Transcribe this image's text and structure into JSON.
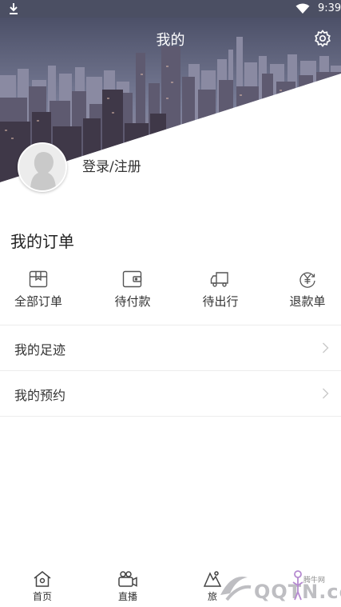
{
  "status_bar": {
    "time": "9:39"
  },
  "header": {
    "title": "我的",
    "settings_icon": "gear-icon"
  },
  "profile": {
    "login_label": "登录/注册",
    "avatar_icon": "default-avatar"
  },
  "orders": {
    "title": "我的订单",
    "items": [
      {
        "label": "全部订单",
        "icon": "box-icon"
      },
      {
        "label": "待付款",
        "icon": "wallet-icon"
      },
      {
        "label": "待出行",
        "icon": "truck-icon"
      },
      {
        "label": "退款单",
        "icon": "refund-icon"
      }
    ]
  },
  "menu": {
    "items": [
      {
        "label": "我的足迹"
      },
      {
        "label": "我的预约"
      }
    ]
  },
  "bottom_nav": {
    "items": [
      {
        "label": "首页",
        "icon": "home-icon"
      },
      {
        "label": "直播",
        "icon": "live-camera-icon"
      },
      {
        "label": "旅",
        "icon": "travel-icon"
      }
    ]
  },
  "watermark": {
    "main": "QQTN.com",
    "small": "腾牛网"
  },
  "colors": {
    "status_bar": "#4b4f63",
    "text_primary": "#333333",
    "divider": "#ececec",
    "icon_stroke": "#555555"
  }
}
